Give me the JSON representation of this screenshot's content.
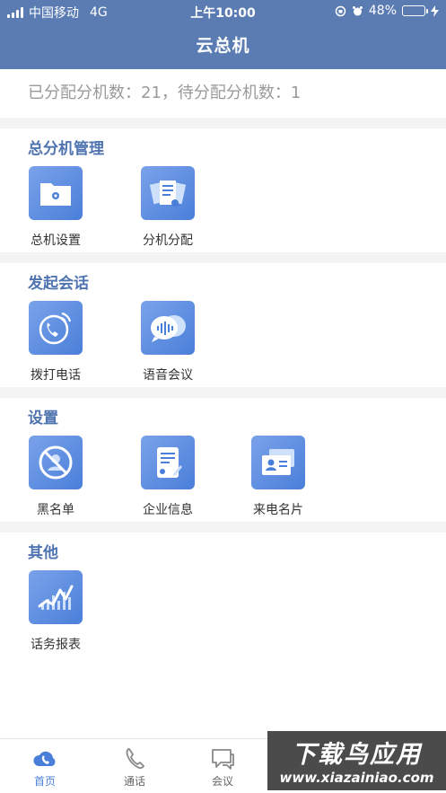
{
  "status_bar": {
    "carrier": "中国移动",
    "network": "4G",
    "time": "上午10:00",
    "battery": "48%",
    "battery_level": 0.48
  },
  "header": {
    "title": "云总机"
  },
  "summary": {
    "text": "已分配分机数：21，待分配分机数：1"
  },
  "sections": [
    {
      "title": "总分机管理",
      "items": [
        {
          "label": "总机设置",
          "icon": "folder-gear-icon"
        },
        {
          "label": "分机分配",
          "icon": "documents-icon"
        }
      ]
    },
    {
      "title": "发起会话",
      "items": [
        {
          "label": "拨打电话",
          "icon": "phone-call-icon"
        },
        {
          "label": "语音会议",
          "icon": "voice-chat-icon"
        }
      ]
    },
    {
      "title": "设置",
      "items": [
        {
          "label": "黑名单",
          "icon": "blocked-user-icon"
        },
        {
          "label": "企业信息",
          "icon": "scroll-document-icon"
        },
        {
          "label": "来电名片",
          "icon": "contact-card-icon"
        }
      ]
    },
    {
      "title": "其他",
      "items": [
        {
          "label": "话务报表",
          "icon": "line-chart-icon"
        }
      ]
    }
  ],
  "tabbar": {
    "items": [
      {
        "label": "首页",
        "icon": "cloud-phone-icon",
        "active": true
      },
      {
        "label": "通话",
        "icon": "phone-icon",
        "active": false
      },
      {
        "label": "会议",
        "icon": "chat-icon",
        "active": false
      }
    ]
  },
  "watermark": {
    "line1": "下载鸟应用",
    "line2": "www.xiazainiao.com"
  },
  "colors": {
    "header": "#5a7cb3",
    "accent": "#4a7fd9",
    "section_title": "#4f74b0"
  }
}
